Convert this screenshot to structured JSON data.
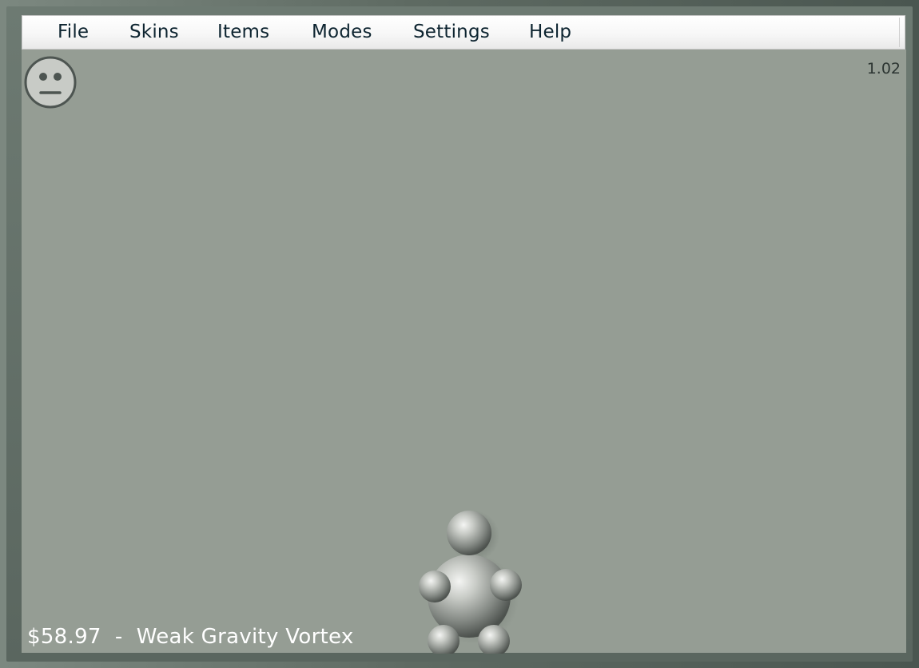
{
  "menu": {
    "file": "File",
    "skins": "Skins",
    "items": "Items",
    "modes": "Modes",
    "settings": "Settings",
    "help": "Help"
  },
  "hud": {
    "version": "1.02",
    "money": "$58.97",
    "separator": "  -  ",
    "weapon": "Weak Gravity Vortex",
    "mood_icon": "neutral-face-icon"
  },
  "colors": {
    "background": "#959d94",
    "frame": "#5e6a62",
    "text_light": "#ffffff",
    "menu_text": "#0d2430"
  }
}
